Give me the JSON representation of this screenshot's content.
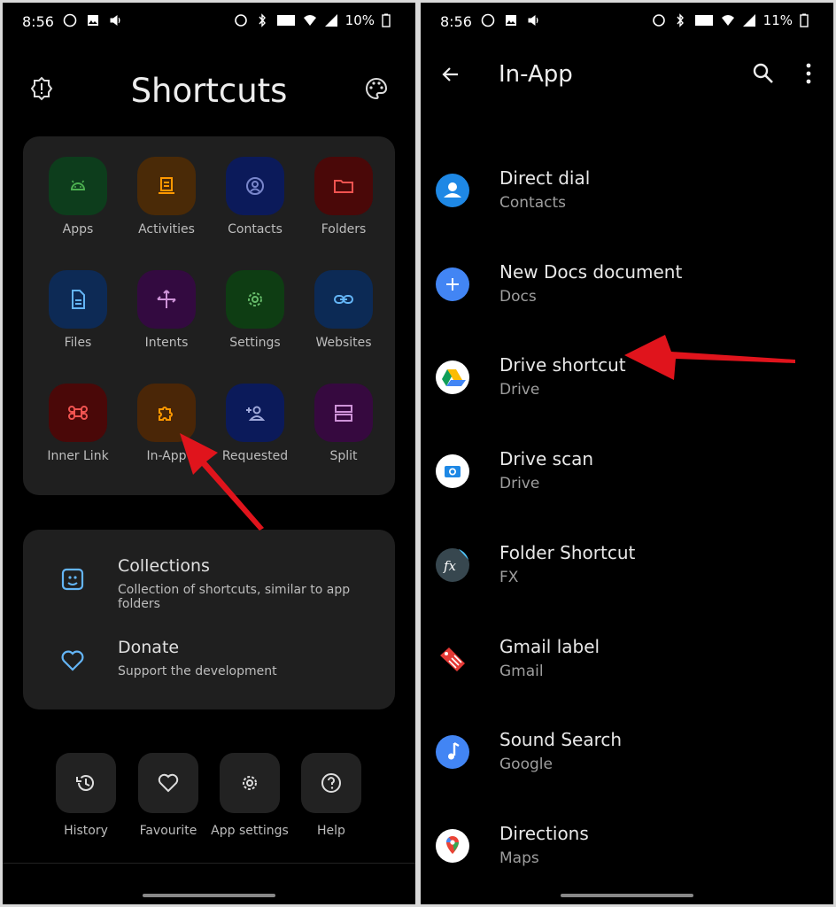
{
  "left": {
    "status": {
      "time": "8:56",
      "battery": "10%"
    },
    "title": "Shortcuts",
    "grid": [
      {
        "label": "Apps",
        "bg": "#0d3d1c",
        "fg": "#4caf50",
        "icon": "android-icon"
      },
      {
        "label": "Activities",
        "bg": "#4a2a07",
        "fg": "#ff9800",
        "icon": "activity-icon"
      },
      {
        "label": "Contacts",
        "bg": "#0b1a5a",
        "fg": "#7986cb",
        "icon": "contact-icon"
      },
      {
        "label": "Folders",
        "bg": "#4a0808",
        "fg": "#ef5350",
        "icon": "folder-icon"
      },
      {
        "label": "Files",
        "bg": "#0d2a55",
        "fg": "#64b5f6",
        "icon": "file-icon"
      },
      {
        "label": "Intents",
        "bg": "#330a40",
        "fg": "#ce93d8",
        "icon": "intent-icon"
      },
      {
        "label": "Settings",
        "bg": "#0e3d13",
        "fg": "#66bb6a",
        "icon": "gear-icon"
      },
      {
        "label": "Websites",
        "bg": "#0c2a55",
        "fg": "#64b5f6",
        "icon": "link-icon"
      },
      {
        "label": "Inner Link",
        "bg": "#4a0808",
        "fg": "#ef5350",
        "icon": "command-icon"
      },
      {
        "label": "In-App",
        "bg": "#4a2607",
        "fg": "#ff9800",
        "icon": "puzzle-icon"
      },
      {
        "label": "Requested",
        "bg": "#0b1a5a",
        "fg": "#9fa8da",
        "icon": "person-add-icon"
      },
      {
        "label": "Split",
        "bg": "#36093f",
        "fg": "#ce93d8",
        "icon": "split-icon"
      }
    ],
    "menu": [
      {
        "title": "Collections",
        "subtitle": "Collection of shortcuts, similar to app folders",
        "icon": "collection-icon"
      },
      {
        "title": "Donate",
        "subtitle": "Support the development",
        "icon": "heart-icon"
      }
    ],
    "bottom": [
      {
        "label": "History",
        "icon": "history-icon"
      },
      {
        "label": "Favourite",
        "icon": "heart-outline-icon"
      },
      {
        "label": "App settings",
        "icon": "app-settings-icon"
      },
      {
        "label": "Help",
        "icon": "help-icon"
      }
    ]
  },
  "right": {
    "status": {
      "time": "8:56",
      "battery": "11%"
    },
    "title": "In-App",
    "items": [
      {
        "title": "Direct dial",
        "subtitle": "Contacts",
        "bg": "#1e88e5",
        "icon": "contacts-app-icon"
      },
      {
        "title": "New Docs document",
        "subtitle": "Docs",
        "bg": "#4285f4",
        "icon": "plus-icon"
      },
      {
        "title": "Drive shortcut",
        "subtitle": "Drive",
        "bg": "#ffffff",
        "icon": "drive-icon"
      },
      {
        "title": "Drive scan",
        "subtitle": "Drive",
        "bg": "#ffffff",
        "icon": "camera-icon"
      },
      {
        "title": "Folder Shortcut",
        "subtitle": "FX",
        "bg": "#37474f",
        "icon": "fx-icon"
      },
      {
        "title": "Gmail label",
        "subtitle": "Gmail",
        "bg": "#000000",
        "icon": "label-icon"
      },
      {
        "title": "Sound Search",
        "subtitle": "Google",
        "bg": "#4285f4",
        "icon": "music-note-icon"
      },
      {
        "title": "Directions",
        "subtitle": "Maps",
        "bg": "#ffffff",
        "icon": "maps-icon"
      }
    ]
  },
  "colors": {
    "arrow": "#e0141c"
  }
}
